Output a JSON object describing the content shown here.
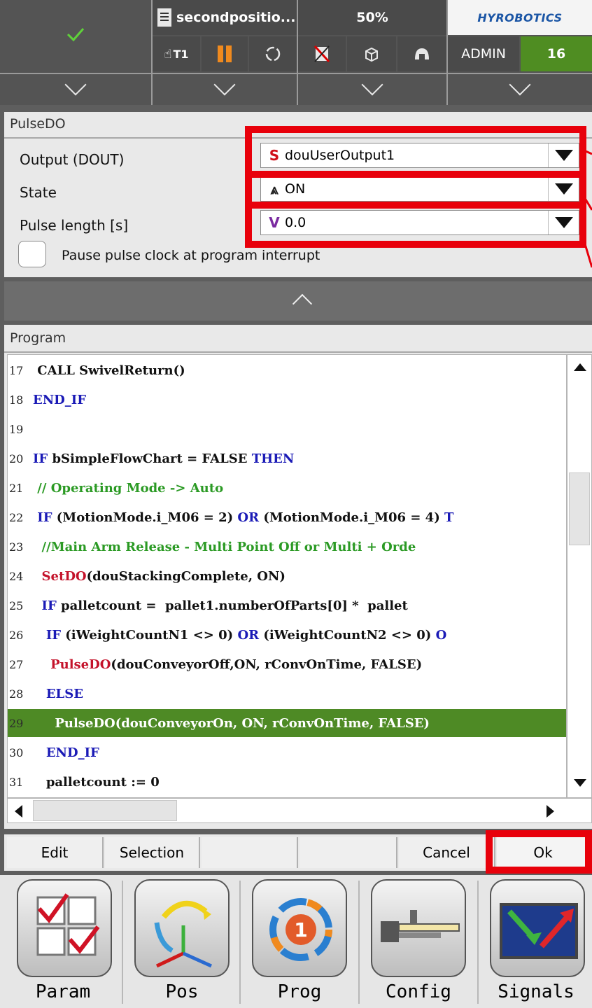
{
  "topbar": {
    "program_name": "secondpositio...",
    "override": "50%",
    "mode": "T1",
    "user": "ADMIN",
    "user_level": "16",
    "brand": "HYROBOTICS"
  },
  "pulse_panel": {
    "title": "PulseDO",
    "fields": [
      {
        "label": "Output (DOUT)",
        "prefix": "S",
        "value": "douUserOutput1"
      },
      {
        "label": "State",
        "prefix": "⩓",
        "value": "ON"
      },
      {
        "label": "Pulse length [s]",
        "prefix": "V",
        "value": "0.0"
      }
    ],
    "checkbox_label": "Pause pulse clock at program interrupt"
  },
  "program": {
    "title": "Program",
    "lines": [
      {
        "n": "17",
        "indent": " ",
        "parts": [
          {
            "t": "CALL SwivelReturn()",
            "c": ""
          }
        ]
      },
      {
        "n": "18",
        "indent": "",
        "parts": [
          {
            "t": "END_IF",
            "c": "kw"
          }
        ]
      },
      {
        "n": "19",
        "indent": "",
        "parts": []
      },
      {
        "n": "20",
        "indent": "",
        "parts": [
          {
            "t": "IF",
            "c": "kw"
          },
          {
            "t": " bSimpleFlowChart = ",
            "c": ""
          },
          {
            "t": "FALSE",
            "c": ""
          },
          {
            "t": " THEN",
            "c": "kw"
          }
        ]
      },
      {
        "n": "21",
        "indent": " ",
        "parts": [
          {
            "t": "// Operating Mode -> Auto",
            "c": "cm"
          }
        ]
      },
      {
        "n": "22",
        "indent": " ",
        "parts": [
          {
            "t": "IF",
            "c": "kw"
          },
          {
            "t": " (MotionMode.i_M06 = 2) ",
            "c": ""
          },
          {
            "t": "OR",
            "c": "kw"
          },
          {
            "t": " (MotionMode.i_M06 = 4) ",
            "c": ""
          },
          {
            "t": "T",
            "c": "kw"
          }
        ]
      },
      {
        "n": "23",
        "indent": "  ",
        "parts": [
          {
            "t": "//Main Arm Release - Multi Point Off or Multi + Orde",
            "c": "cm"
          }
        ]
      },
      {
        "n": "24",
        "indent": "  ",
        "parts": [
          {
            "t": "SetDO",
            "c": "fn"
          },
          {
            "t": "(douStackingComplete, ON)",
            "c": ""
          }
        ]
      },
      {
        "n": "25",
        "indent": "  ",
        "parts": [
          {
            "t": "IF",
            "c": "kw"
          },
          {
            "t": " palletcount =  pallet1.numberOfParts[0] *  pallet",
            "c": ""
          }
        ]
      },
      {
        "n": "26",
        "indent": "   ",
        "parts": [
          {
            "t": "IF",
            "c": "kw"
          },
          {
            "t": " (iWeightCountN1 <> 0) ",
            "c": ""
          },
          {
            "t": "OR",
            "c": "kw"
          },
          {
            "t": " (iWeightCountN2 <> 0) ",
            "c": ""
          },
          {
            "t": "O",
            "c": "kw"
          }
        ]
      },
      {
        "n": "27",
        "indent": "    ",
        "parts": [
          {
            "t": "PulseDO",
            "c": "fn"
          },
          {
            "t": "(douConveyorOff,ON, rConvOnTime, FALSE)",
            "c": ""
          }
        ]
      },
      {
        "n": "28",
        "indent": "   ",
        "parts": [
          {
            "t": "ELSE",
            "c": "kw"
          }
        ]
      },
      {
        "n": "29",
        "indent": "     ",
        "parts": [
          {
            "t": "PulseDO",
            "c": "fn"
          },
          {
            "t": "(douConveyorOn, ON, rConvOnTime, FALSE)",
            "c": ""
          }
        ],
        "active": true
      },
      {
        "n": "30",
        "indent": "   ",
        "parts": [
          {
            "t": "END_IF",
            "c": "kw"
          }
        ]
      },
      {
        "n": "31",
        "indent": "   ",
        "parts": [
          {
            "t": "palletcount := 0",
            "c": ""
          }
        ]
      }
    ]
  },
  "actions": {
    "edit": "Edit",
    "selection": "Selection",
    "cancel": "Cancel",
    "ok": "Ok"
  },
  "nav": [
    {
      "label": "Param",
      "icon": "param-checklist-icon"
    },
    {
      "label": "Pos",
      "icon": "pos-axes-icon"
    },
    {
      "label": "Prog",
      "icon": "prog-cycle-icon"
    },
    {
      "label": "Config",
      "icon": "config-tool-icon"
    },
    {
      "label": "Signals",
      "icon": "signals-monitor-icon"
    }
  ],
  "colors": {
    "highlight": "#e8000b",
    "active_line": "#4e8a25",
    "keyword": "#1a1ab6",
    "comment": "#2b9a24",
    "function": "#c4122a"
  }
}
